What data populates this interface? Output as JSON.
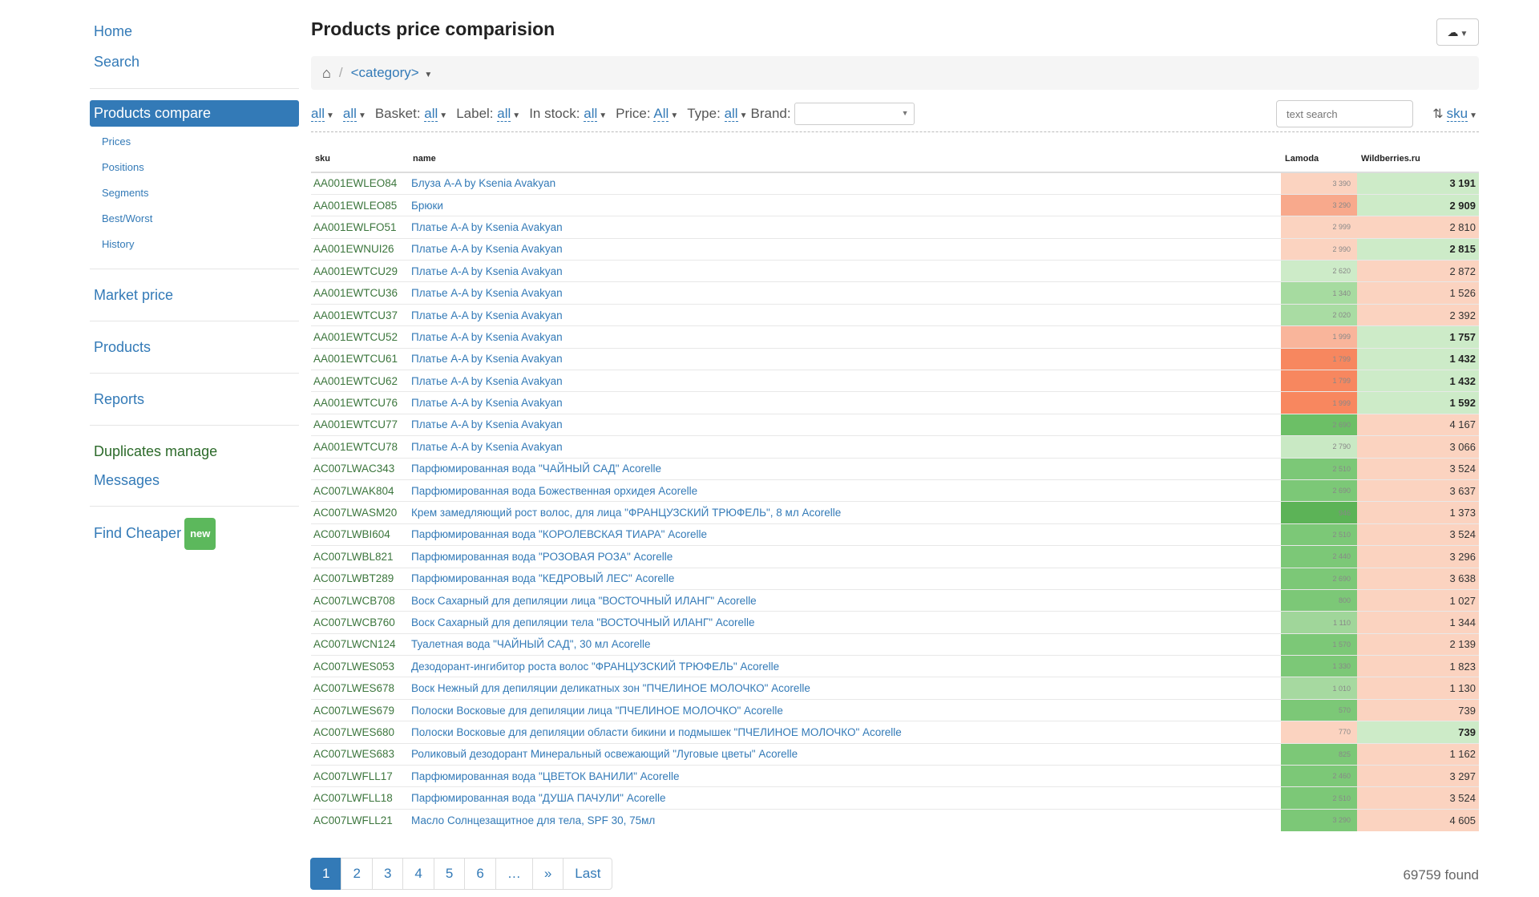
{
  "nav": {
    "home": "Home",
    "search": "Search",
    "products_compare": "Products compare",
    "sub": [
      "Prices",
      "Positions",
      "Segments",
      "Best/Worst",
      "History"
    ],
    "market_price": "Market price",
    "products": "Products",
    "reports": "Reports",
    "duplicates": "Duplicates manage",
    "messages": "Messages",
    "find_cheaper": "Find Cheaper",
    "new_badge": "new"
  },
  "header": {
    "title": "Products price comparision"
  },
  "breadcrumb": {
    "category": "<category>"
  },
  "filters": {
    "f1": "all",
    "f2": "all",
    "basket_label": "Basket:",
    "basket_value": "all",
    "label_label": "Label:",
    "label_value": "all",
    "instock_label": "In stock:",
    "instock_value": "all",
    "price_label": "Price:",
    "price_value": "All",
    "type_label": "Type:",
    "type_value": "all",
    "brand_label": "Brand:",
    "search_placeholder": "text search",
    "sort_value": "sku"
  },
  "table": {
    "columns": [
      "sku",
      "name",
      "Lamoda",
      "Wildberries.ru"
    ],
    "rows": [
      {
        "sku": "AA001EWLEO84",
        "name": "Блуза A-A by Ksenia Avakyan",
        "lamoda": "3 390",
        "wb": "3 191",
        "best": true,
        "c1": "#fbd3c0"
      },
      {
        "sku": "AA001EWLEO85",
        "name": "Брюки",
        "lamoda": "3 290",
        "wb": "2 909",
        "best": true,
        "c1": "#f8a98c"
      },
      {
        "sku": "AA001EWLFO51",
        "name": "Платье A-A by Ksenia Avakyan",
        "lamoda": "2 999",
        "wb": "2 810",
        "best": false,
        "c1": "#fbd3c0"
      },
      {
        "sku": "AA001EWNUI26",
        "name": "Платье A-A by Ksenia Avakyan",
        "lamoda": "2 990",
        "wb": "2 815",
        "best": true,
        "c1": "#fbd3c0"
      },
      {
        "sku": "AA001EWTCU29",
        "name": "Платье A-A by Ksenia Avakyan",
        "lamoda": "2 620",
        "wb": "2 872",
        "best": false,
        "c1": "#cdebc8"
      },
      {
        "sku": "AA001EWTCU36",
        "name": "Платье A-A by Ksenia Avakyan",
        "lamoda": "1 340",
        "wb": "1 526",
        "best": false,
        "c1": "#a6dba0"
      },
      {
        "sku": "AA001EWTCU37",
        "name": "Платье A-A by Ksenia Avakyan",
        "lamoda": "2 020",
        "wb": "2 392",
        "best": false,
        "c1": "#a9dca3"
      },
      {
        "sku": "AA001EWTCU52",
        "name": "Платье A-A by Ksenia Avakyan",
        "lamoda": "1 999",
        "wb": "1 757",
        "best": true,
        "c1": "#f9b59b"
      },
      {
        "sku": "AA001EWTCU61",
        "name": "Платье A-A by Ksenia Avakyan",
        "lamoda": "1 799",
        "wb": "1 432",
        "best": true,
        "c1": "#f7875f"
      },
      {
        "sku": "AA001EWTCU62",
        "name": "Платье A-A by Ksenia Avakyan",
        "lamoda": "1 799",
        "wb": "1 432",
        "best": true,
        "c1": "#f7875f"
      },
      {
        "sku": "AA001EWTCU76",
        "name": "Платье A-A by Ksenia Avakyan",
        "lamoda": "1 999",
        "wb": "1 592",
        "best": true,
        "c1": "#f8875f"
      },
      {
        "sku": "AA001EWTCU77",
        "name": "Платье A-A by Ksenia Avakyan",
        "lamoda": "2 690",
        "wb": "4 167",
        "best": false,
        "c1": "#6cbf66"
      },
      {
        "sku": "AA001EWTCU78",
        "name": "Платье A-A by Ksenia Avakyan",
        "lamoda": "2 790",
        "wb": "3 066",
        "best": false,
        "c1": "#c9e9c4"
      },
      {
        "sku": "AC007LWAC343",
        "name": "Парфюмированная вода \"ЧАЙНЫЙ САД\" Acorelle",
        "lamoda": "2 510",
        "wb": "3 524",
        "best": false,
        "c1": "#7cc877"
      },
      {
        "sku": "AC007LWAK804",
        "name": "Парфюмированная вода Божественная орхидея Acorelle",
        "lamoda": "2 690",
        "wb": "3 637",
        "best": false,
        "c1": "#7cc877"
      },
      {
        "sku": "AC007LWASM20",
        "name": "Крем замедляющий рост волос, для лица \"ФРАНЦУЗСКИЙ ТРЮФЕЛЬ\", 8 мл Acorelle",
        "lamoda": "946",
        "wb": "1 373",
        "best": false,
        "c1": "#5cb357"
      },
      {
        "sku": "AC007LWBI604",
        "name": "Парфюмированная вода \"КОРОЛЕВСКАЯ ТИАРА\" Acorelle",
        "lamoda": "2 510",
        "wb": "3 524",
        "best": false,
        "c1": "#7cc877"
      },
      {
        "sku": "AC007LWBL821",
        "name": "Парфюмированная вода \"РОЗОВАЯ РОЗА\" Acorelle",
        "lamoda": "2 440",
        "wb": "3 296",
        "best": false,
        "c1": "#7cc877"
      },
      {
        "sku": "AC007LWBT289",
        "name": "Парфюмированная вода \"КЕДРОВЫЙ ЛЕС\" Acorelle",
        "lamoda": "2 690",
        "wb": "3 638",
        "best": false,
        "c1": "#7cc877"
      },
      {
        "sku": "AC007LWCB708",
        "name": "Воск Сахарный для депиляции лица \"ВОСТОЧНЫЙ ИЛАНГ\" Acorelle",
        "lamoda": "800",
        "wb": "1 027",
        "best": false,
        "c1": "#7cc877"
      },
      {
        "sku": "AC007LWCB760",
        "name": "Воск Сахарный для депиляции тела \"ВОСТОЧНЫЙ ИЛАНГ\" Acorelle",
        "lamoda": "1 110",
        "wb": "1 344",
        "best": false,
        "c1": "#a0d69a"
      },
      {
        "sku": "AC007LWCN124",
        "name": "Туалетная вода \"ЧАЙНЫЙ САД\", 30 мл Acorelle",
        "lamoda": "1 570",
        "wb": "2 139",
        "best": false,
        "c1": "#7cc877"
      },
      {
        "sku": "AC007LWES053",
        "name": "Дезодорант-ингибитор роста волос \"ФРАНЦУЗСКИЙ ТРЮФЕЛЬ\" Acorelle",
        "lamoda": "1 330",
        "wb": "1 823",
        "best": false,
        "c1": "#7cc877"
      },
      {
        "sku": "AC007LWES678",
        "name": "Воск Нежный для депиляции деликатных зон \"ПЧЕЛИНОЕ МОЛОЧКО\" Acorelle",
        "lamoda": "1 010",
        "wb": "1 130",
        "best": false,
        "c1": "#a6d9a0"
      },
      {
        "sku": "AC007LWES679",
        "name": "Полоски Восковые для депиляции лица \"ПЧЕЛИНОЕ МОЛОЧКО\" Acorelle",
        "lamoda": "570",
        "wb": "739",
        "best": false,
        "c1": "#7cc877"
      },
      {
        "sku": "AC007LWES680",
        "name": "Полоски Восковые для депиляции области бикини и подмышек \"ПЧЕЛИНОЕ МОЛОЧКО\" Acorelle",
        "lamoda": "770",
        "wb": "739",
        "best": true,
        "c1": "#fbd3c0"
      },
      {
        "sku": "AC007LWES683",
        "name": "Роликовый дезодорант Минеральный освежающий \"Луговые цветы\" Acorelle",
        "lamoda": "825",
        "wb": "1 162",
        "best": false,
        "c1": "#7cc877"
      },
      {
        "sku": "AC007LWFLL17",
        "name": "Парфюмированная вода \"ЦВЕТОК ВАНИЛИ\" Acorelle",
        "lamoda": "2 460",
        "wb": "3 297",
        "best": false,
        "c1": "#7cc877"
      },
      {
        "sku": "AC007LWFLL18",
        "name": "Парфюмированная вода \"ДУША ПАЧУЛИ\" Acorelle",
        "lamoda": "2 510",
        "wb": "3 524",
        "best": false,
        "c1": "#7cc877"
      },
      {
        "sku": "AC007LWFLL21",
        "name": "Масло Солнцезащитное для тела, SPF 30, 75мл",
        "lamoda": "3 290",
        "wb": "4 605",
        "best": false,
        "c1": "#7cc877"
      }
    ]
  },
  "colors": {
    "wb_best": "#cdebc8",
    "wb_worse": "#fbd3c0",
    "accent": "#337ab7"
  },
  "pagination": {
    "pages": [
      "1",
      "2",
      "3",
      "4",
      "5",
      "6",
      "…",
      "»",
      "Last"
    ],
    "found": "69759 found"
  }
}
